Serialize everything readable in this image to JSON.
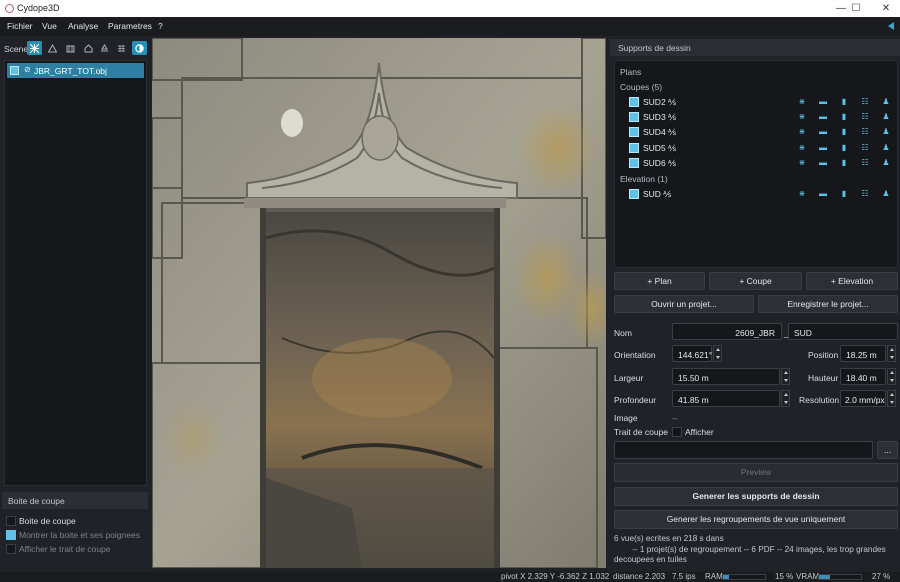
{
  "window": {
    "title": "Cydope3D",
    "minimize": "—",
    "maximize": "☐",
    "close": "✕"
  },
  "menu": {
    "items": [
      "Fichier",
      "Vue",
      "Analyse",
      "Parametres",
      "?"
    ]
  },
  "scene": {
    "label": "Scene",
    "toolbar_icons": [
      "mesh-icon",
      "triangle-icon",
      "building-icon",
      "house-icon",
      "stack-icon",
      "layers-icon",
      "sphere-icon"
    ],
    "item": {
      "name": "JBR_GRT_TOT.obj",
      "checked": true
    }
  },
  "boite": {
    "title": "Boite de coupe",
    "options": [
      {
        "label": "Boite de coupe",
        "checked": false,
        "enabled": true
      },
      {
        "label": "Montrer la boite et ses poignees",
        "checked": true,
        "enabled": false
      },
      {
        "label": "Afficher le trait de coupe",
        "checked": false,
        "enabled": false
      }
    ]
  },
  "supports": {
    "title": "Supports de dessin",
    "tree": {
      "root": "Plans",
      "coupes_label": "Coupes (5)",
      "coupes": [
        "SUD2 ⅍",
        "SUD3 ⅍",
        "SUD4 ⅍",
        "SUD5 ⅍",
        "SUD6 ⅍"
      ],
      "elevation_label": "Elevation (1)",
      "elevations": [
        "SUD ⅍"
      ],
      "row_icons": [
        "mesh-icon",
        "folder-icon",
        "book-icon",
        "list-icon",
        "person-icon"
      ]
    },
    "buttons": {
      "add_plan": "+ Plan",
      "add_coupe": "+ Coupe",
      "add_elevation": "+ Elevation",
      "open_project": "Ouvrir un projet...",
      "save_project": "Enregistrer le projet...",
      "preview": "Preview",
      "generate": "Generer les supports de dessin",
      "generate_groups": "Generer les regroupements de vue uniquement",
      "browse": "..."
    },
    "form": {
      "nom_label": "Nom",
      "nom_value": "2609_JBR",
      "nom_sep": "_",
      "nom_suffix": "SUD",
      "orientation_label": "Orientation",
      "orientation_value": "144.621°",
      "position_label": "Position",
      "position_value": "18.25 m",
      "largeur_label": "Largeur",
      "largeur_value": "15.50 m",
      "hauteur_label": "Hauteur",
      "hauteur_value": "18.40 m",
      "profondeur_label": "Profondeur",
      "profondeur_value": "41.85 m",
      "resolution_label": "Resolution",
      "resolution_value": "2.0 mm/px",
      "image_label": "Image",
      "image_value": "--",
      "trait_label": "Trait de coupe",
      "afficher_label": "Afficher",
      "afficher_checked": false,
      "path_value": ""
    },
    "log": [
      "6 vue(s) ecrites en 218 s dans",
      "        -- 1 projet(s) de regroupement -- 6 PDF -- 24 images, les trop grandes decoupees en tuiles"
    ]
  },
  "status": {
    "pivot": "pivot  X 2.329  Y -6.362  Z 1.032",
    "distance": "distance  2.203",
    "fps": "7.5 ips",
    "ram_label": "RAM",
    "ram_percent": 15,
    "ram_text": "15 %",
    "vram_label": "VRAM",
    "vram_percent": 27,
    "vram_text": "27 %"
  }
}
